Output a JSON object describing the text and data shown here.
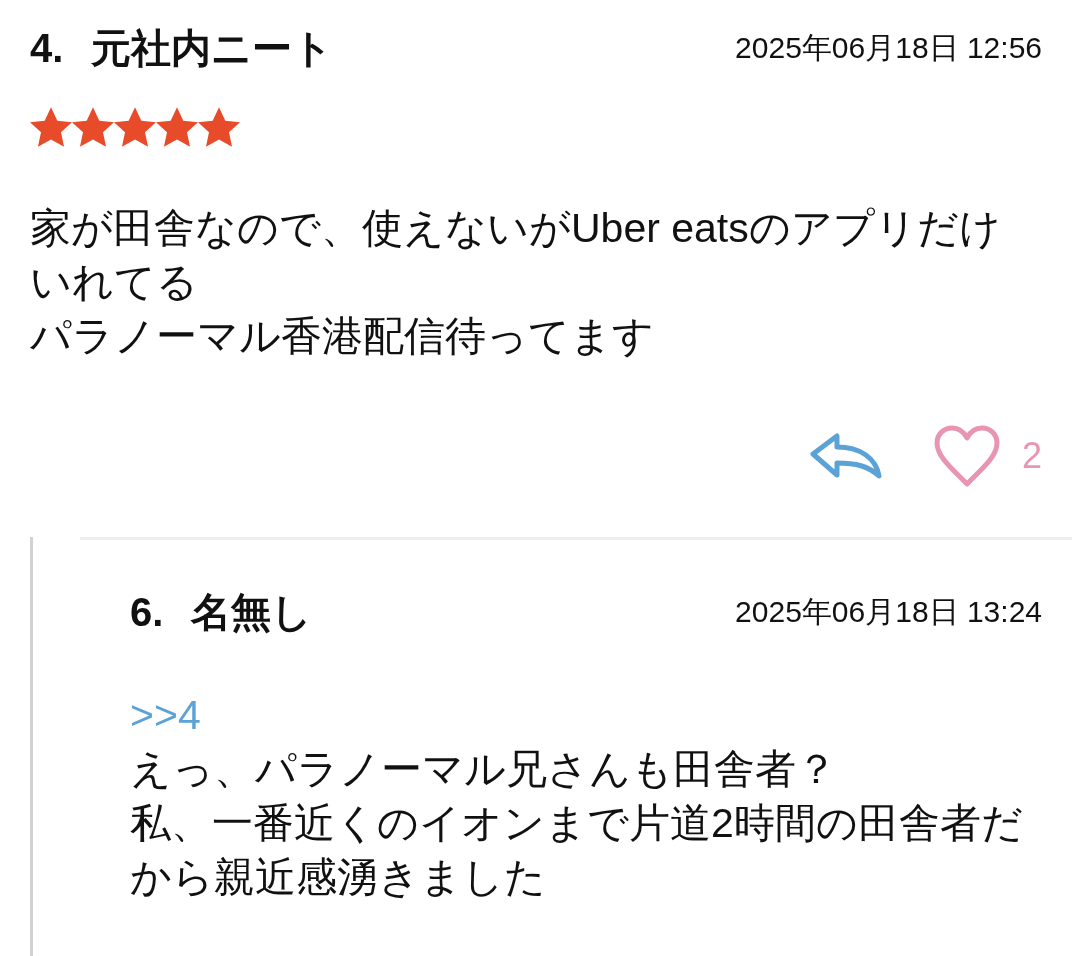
{
  "comments": [
    {
      "number": "4.",
      "name": "元社内ニート",
      "date": "2025年06月18日 12:56",
      "stars": 5,
      "body": [
        "家が田舎なので、使えないがUber eatsのアプリだけいれてる",
        "パラノーマル香港配信待ってます"
      ],
      "likes": "2",
      "replies": [
        {
          "number": "6.",
          "name": "名無し",
          "date": "2025年06月18日 13:24",
          "anchor": ">>4",
          "body": [
            "えっ、パラノーマル兄さんも田舎者？",
            "私、一番近くのイオンまで片道2時間の田舎者だから親近感湧きました"
          ]
        }
      ]
    }
  ]
}
